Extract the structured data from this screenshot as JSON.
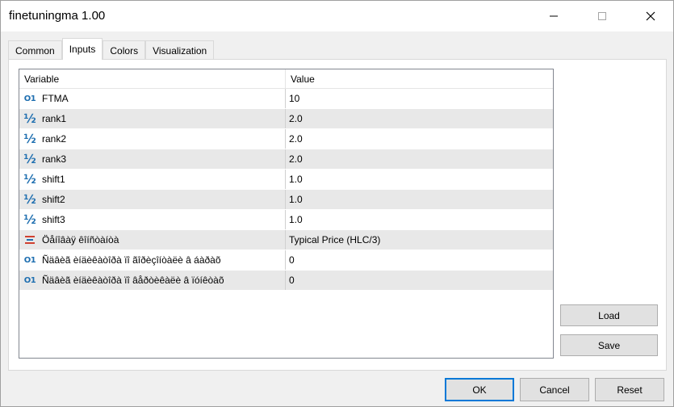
{
  "window": {
    "title": "finetuningma 1.00"
  },
  "tabs": [
    {
      "label": "Common",
      "active": false
    },
    {
      "label": "Inputs",
      "active": true
    },
    {
      "label": "Colors",
      "active": false
    },
    {
      "label": "Visualization",
      "active": false
    }
  ],
  "grid": {
    "headers": {
      "variable": "Variable",
      "value": "Value"
    },
    "rows": [
      {
        "icon": "int-icon",
        "icon_text": "O1",
        "variable": "FTMA",
        "value": "10"
      },
      {
        "icon": "double-icon",
        "icon_text": "½",
        "variable": "rank1",
        "value": "2.0"
      },
      {
        "icon": "double-icon",
        "icon_text": "½",
        "variable": "rank2",
        "value": "2.0"
      },
      {
        "icon": "double-icon",
        "icon_text": "½",
        "variable": "rank3",
        "value": "2.0"
      },
      {
        "icon": "double-icon",
        "icon_text": "½",
        "variable": "shift1",
        "value": "1.0"
      },
      {
        "icon": "double-icon",
        "icon_text": "½",
        "variable": "shift2",
        "value": "1.0"
      },
      {
        "icon": "double-icon",
        "icon_text": "½",
        "variable": "shift3",
        "value": "1.0"
      },
      {
        "icon": "enum-icon",
        "icon_text": "",
        "variable": "Öåíîâàÿ êîíñòàíòà",
        "value": "Typical Price (HLC/3)"
      },
      {
        "icon": "int-icon",
        "icon_text": "O1",
        "variable": "Ñäâèã èíäèêàòîðà ïî ãîðèçîíòàëè â áàðàõ",
        "value": "0"
      },
      {
        "icon": "int-icon",
        "icon_text": "O1",
        "variable": "Ñäâèã èíäèêàòîðà ïî âåðòèêàëè â ïóíêòàõ",
        "value": "0"
      }
    ]
  },
  "buttons": {
    "load": "Load",
    "save": "Save",
    "ok": "OK",
    "cancel": "Cancel",
    "reset": "Reset"
  },
  "colors": {
    "accent": "#0078d7",
    "icon": "#1f6fb0",
    "row_alt": "#e8e8e8"
  }
}
